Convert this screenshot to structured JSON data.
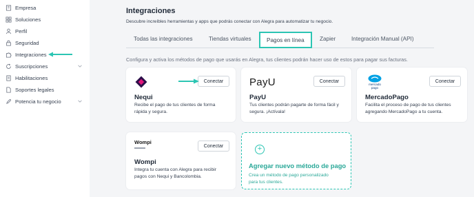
{
  "sidebar": {
    "items": [
      {
        "label": "Empresa",
        "icon": "building-icon"
      },
      {
        "label": "Soluciones",
        "icon": "grid-icon"
      },
      {
        "label": "Perfil",
        "icon": "user-icon"
      },
      {
        "label": "Seguridad",
        "icon": "lock-icon"
      },
      {
        "label": "Integraciones",
        "icon": "puzzle-icon"
      },
      {
        "label": "Suscripciones",
        "icon": "refresh-icon"
      },
      {
        "label": "Habilitaciones",
        "icon": "document-icon"
      },
      {
        "label": "Soportes legales",
        "icon": "file-icon"
      },
      {
        "label": "Potencia tu negocio",
        "icon": "rocket-icon"
      }
    ]
  },
  "header": {
    "title": "Integraciones",
    "subtitle": "Descubre increíbles herramientas y apps que podrás conectar con Alegra para automatizar tu negocio."
  },
  "tabs": [
    {
      "label": "Todas las integraciones"
    },
    {
      "label": "Tiendas virtuales"
    },
    {
      "label": "Pagos en línea"
    },
    {
      "label": "Zapier"
    },
    {
      "label": "Integración Manual (API)"
    }
  ],
  "intro": "Configura y activa los métodos de pago que usarás en Alegra, tus clientes podrán hacer uso de estos para pagar sus facturas.",
  "cards": [
    {
      "name": "Nequi",
      "desc": "Recibe el pago de tus clientes de forma rápida y segura.",
      "button": "Conectar"
    },
    {
      "name": "PayU",
      "desc": "Tus clientes podrán pagarte de forma fácil y segura. ¡Actívala!",
      "button": "Conectar",
      "logo_text": "PayU"
    },
    {
      "name": "MercadoPago",
      "desc": "Facilita el proceso de pago de tus clientes agregando MercadoPago a tu cuenta.",
      "button": "Conectar",
      "logo_text": "mercado pago"
    },
    {
      "name": "Wompi",
      "desc": "Integra tu cuenta con Alegra para recibir pagos con Nequi y Bancolombia.",
      "button": "Conectar",
      "logo_text": "Wompi"
    }
  ],
  "add_method": {
    "title": "Agregar nuevo método de pago",
    "desc": "Crea un método de pago personalizado para tus clientes."
  },
  "colors": {
    "accent": "#2cc5b3",
    "accent_text": "#2aa898",
    "background": "#f4f5f7"
  }
}
